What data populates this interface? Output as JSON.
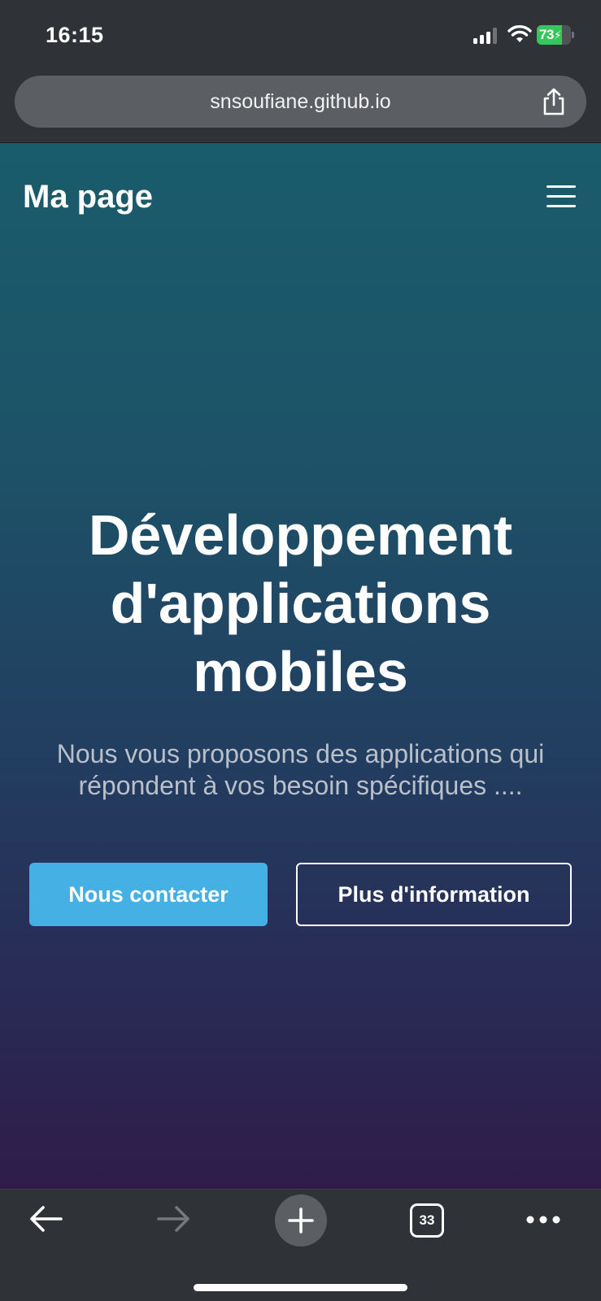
{
  "status_bar": {
    "time": "16:15",
    "battery_level": "73",
    "battery_fraction": 0.73,
    "battery_color": "#34c759",
    "icons": [
      "cellular-signal-icon",
      "wifi-icon",
      "battery-charging-icon"
    ]
  },
  "browser": {
    "url": "snsoufiane.github.io",
    "share_icon": "share-icon",
    "tab_count": "33",
    "toolbar_icons": [
      "back-arrow-icon",
      "forward-arrow-icon",
      "plus-icon",
      "tabs-icon",
      "more-icon"
    ]
  },
  "page": {
    "brand": "Ma page",
    "menu_icon": "hamburger-menu-icon",
    "hero": {
      "title_lines": [
        "Développement",
        "d'applications",
        "mobiles"
      ],
      "subtitle": "Nous vous proposons des applications qui répondent à vos besoin spécifiques ...."
    },
    "buttons": {
      "primary": "Nous contacter",
      "secondary": "Plus d'information"
    },
    "colors": {
      "primary_button": "#44b0e3",
      "gradient_top": "#195c6b",
      "gradient_bottom": "#2f1c4a"
    }
  }
}
